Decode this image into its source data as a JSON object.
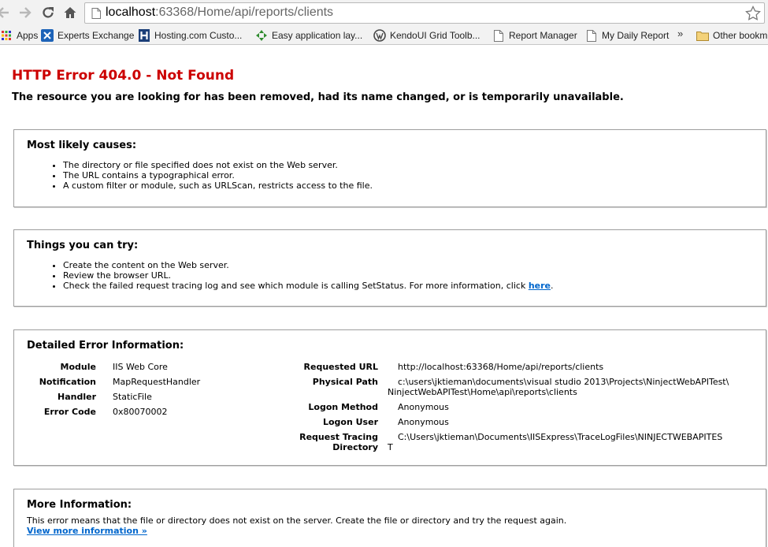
{
  "browser": {
    "url_host": "localhost",
    "url_rest": ":63368/Home/api/reports/clients",
    "bookmarks": [
      {
        "label": "Apps",
        "icon": "apps-grid-icon"
      },
      {
        "label": "Experts Exchange",
        "icon": "experts-exchange-icon"
      },
      {
        "label": "Hosting.com Custo...",
        "icon": "hosting-icon"
      },
      {
        "label": "Easy application lay...",
        "icon": "easy-app-icon"
      },
      {
        "label": "KendoUI Grid Toolb...",
        "icon": "wordpress-icon"
      },
      {
        "label": "Report Manager",
        "icon": "page-icon"
      },
      {
        "label": "My Daily Report",
        "icon": "page-icon"
      },
      {
        "label": "Other bookm",
        "icon": "folder-icon"
      }
    ],
    "overflow_label": "»"
  },
  "error": {
    "title": "HTTP Error 404.0 - Not Found",
    "subtitle": "The resource you are looking for has been removed, had its name changed, or is temporarily unavailable."
  },
  "causes": {
    "heading": "Most likely causes:",
    "items": [
      "The directory or file specified does not exist on the Web server.",
      "The URL contains a typographical error.",
      "A custom filter or module, such as URLScan, restricts access to the file."
    ]
  },
  "try": {
    "heading": "Things you can try:",
    "items": [
      "Create the content on the Web server.",
      "Review the browser URL.",
      "Check the failed request tracing log and see which module is calling SetStatus. For more information, click "
    ],
    "link_text": "here",
    "link_suffix": "."
  },
  "details": {
    "heading": "Detailed Error Information:",
    "module_label": "Module",
    "module_value": "IIS Web Core",
    "notification_label": "Notification",
    "notification_value": "MapRequestHandler",
    "handler_label": "Handler",
    "handler_value": "StaticFile",
    "error_code_label": "Error Code",
    "error_code_value": "0x80070002",
    "requested_url_label": "Requested URL",
    "requested_url_value": "http://localhost:63368/Home/api/reports/clients",
    "physical_path_label": "Physical Path",
    "physical_path_line1": "c:\\users\\jktieman\\documents\\visual studio 2013\\Projects\\NinjectWebAPITest\\",
    "physical_path_line2": "NinjectWebAPITest\\Home\\api\\reports\\clients",
    "logon_method_label": "Logon Method",
    "logon_method_value": "Anonymous",
    "logon_user_label": "Logon User",
    "logon_user_value": "Anonymous",
    "tracing_label_line1": "Request Tracing",
    "tracing_label_line2": "Directory",
    "tracing_line1": "C:\\Users\\jktieman\\Documents\\IISExpress\\TraceLogFiles\\NINJECTWEBAPITES",
    "tracing_line2": "T"
  },
  "more": {
    "heading": "More Information:",
    "text": "This error means that the file or directory does not exist on the server. Create the file or directory and try the request again.",
    "link": "View more information »"
  },
  "colors": {
    "error_red": "#cc0000",
    "link_blue": "#0066cc",
    "chrome_bg": "#f2f2f2"
  }
}
